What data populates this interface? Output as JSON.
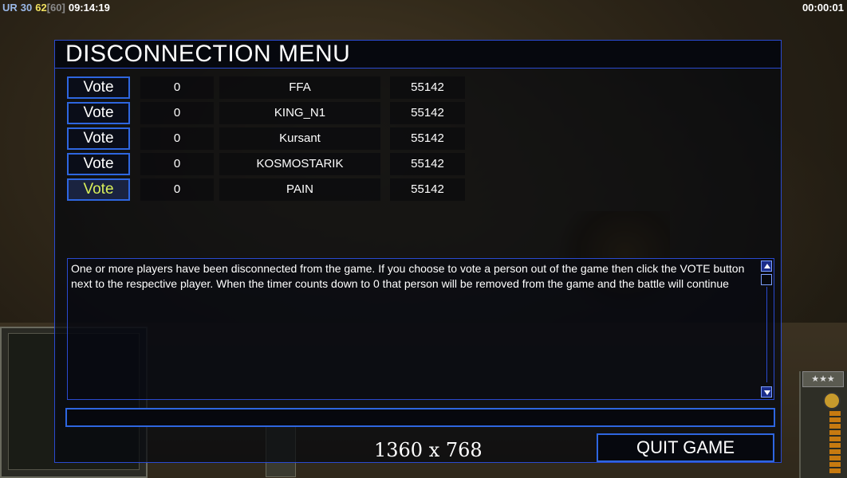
{
  "hud": {
    "faction": "UR",
    "value1": "30",
    "value2": "62",
    "value3": "[60]",
    "clock": "09:14:19",
    "timer": "00:00:01",
    "stars": "★★★"
  },
  "menu": {
    "title": "DISCONNECTION MENU",
    "vote_label": "Vote",
    "players": [
      {
        "count": "0",
        "name": "FFA",
        "score": "55142"
      },
      {
        "count": "0",
        "name": "KING_N1",
        "score": "55142"
      },
      {
        "count": "0",
        "name": "Kursant",
        "score": "55142"
      },
      {
        "count": "0",
        "name": "KOSMOSTARIK",
        "score": "55142"
      },
      {
        "count": "0",
        "name": "PAIN",
        "score": "55142"
      }
    ],
    "message": "One or more players have been disconnected from the game. If you choose to vote a person out of the game then click the VOTE button next to the respective player. When the timer counts down to 0 that person will be removed from the game and the battle will continue",
    "resolution": "1360 x 768",
    "quit_label": "QUIT GAME"
  },
  "colors": {
    "accent_border": "#2e66e0",
    "highlight_text": "#d9f05a"
  }
}
